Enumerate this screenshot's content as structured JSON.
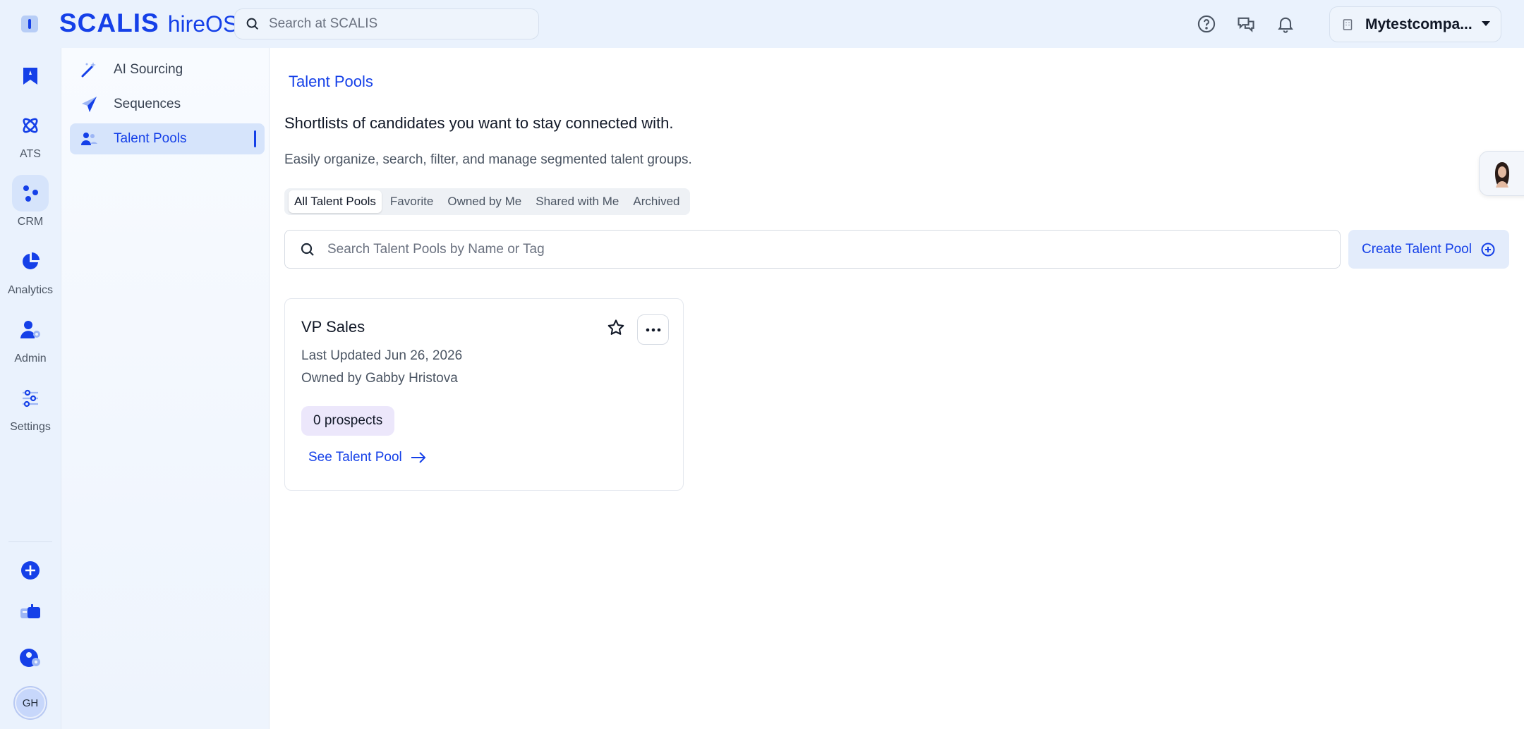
{
  "brand": {
    "logo": "SCALIS",
    "product": "hireOS"
  },
  "top_search": {
    "placeholder": "Search at SCALIS"
  },
  "company": {
    "name": "Mytestcompa..."
  },
  "rail": {
    "items": [
      {
        "label": ""
      },
      {
        "label": "ATS"
      },
      {
        "label": "CRM"
      },
      {
        "label": "Analytics"
      },
      {
        "label": "Admin"
      },
      {
        "label": "Settings"
      }
    ],
    "user_initials": "GH"
  },
  "subnav": {
    "items": [
      {
        "label": "AI Sourcing"
      },
      {
        "label": "Sequences"
      },
      {
        "label": "Talent Pools"
      }
    ]
  },
  "main": {
    "breadcrumb": "Talent Pools",
    "headline": "Shortlists of candidates you want to stay connected with.",
    "subline": "Easily organize, search, filter, and manage segmented talent groups.",
    "filters": [
      "All Talent Pools",
      "Favorite",
      "Owned by Me",
      "Shared with Me",
      "Archived"
    ],
    "search": {
      "placeholder": "Search Talent Pools by Name or Tag"
    },
    "create_label": "Create Talent Pool",
    "card": {
      "title": "VP Sales",
      "updated": "Last Updated Jun 26, 2026",
      "owner": "Owned by Gabby Hristova",
      "badge": "0 prospects",
      "link": "See Talent Pool"
    }
  },
  "colors": {
    "accent": "#1540e8",
    "rail_bg": "#eaf2fd",
    "active_bg": "#d6e4fb",
    "badge_bg": "#ece7fb"
  }
}
